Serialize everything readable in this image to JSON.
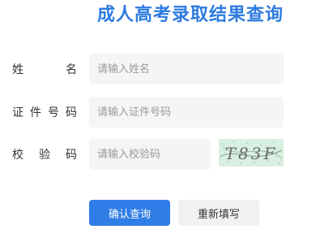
{
  "page_title": "成人高考录取结果查询",
  "form": {
    "name": {
      "label_chars": [
        "姓",
        "名"
      ],
      "placeholder": "请输入姓名",
      "value": ""
    },
    "id_number": {
      "label_chars": [
        "证",
        "件",
        "号",
        "码"
      ],
      "placeholder": "请输入证件号码",
      "value": ""
    },
    "captcha": {
      "label_chars": [
        "校",
        "验",
        "码"
      ],
      "placeholder": "请输入校验码",
      "value": "",
      "image_text": "T83F"
    }
  },
  "buttons": {
    "submit_label": "确认查询",
    "reset_label": "重新填写"
  },
  "colors": {
    "accent": "#2f7de6",
    "title": "#2d7be0",
    "input_bg": "#f5f5f5",
    "captcha_bg": "#d9efe1"
  }
}
